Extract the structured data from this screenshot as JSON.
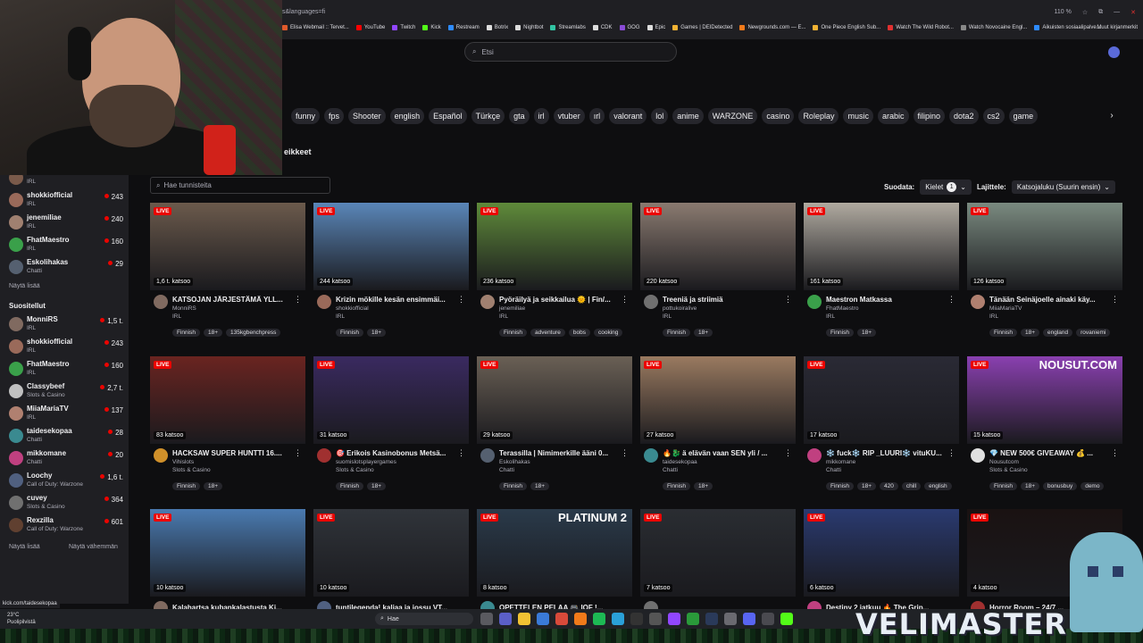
{
  "browser": {
    "url_fragment": "s&languages=fi",
    "zoom": "110 %",
    "bookmarks": [
      {
        "label": "Elisa Webmail :: Tervet...",
        "color": "#e05a2b"
      },
      {
        "label": "YouTube",
        "color": "#ff0000"
      },
      {
        "label": "Twitch",
        "color": "#9146ff"
      },
      {
        "label": "Kick",
        "color": "#53fc18"
      },
      {
        "label": "Restream",
        "color": "#2e8bff"
      },
      {
        "label": "Botrix",
        "color": "#dddddd"
      },
      {
        "label": "Nightbot",
        "color": "#dddddd"
      },
      {
        "label": "Streamlabs",
        "color": "#31c3a2"
      },
      {
        "label": "CDK",
        "color": "#dddddd"
      },
      {
        "label": "GOG",
        "color": "#8a4bd6"
      },
      {
        "label": "Epic",
        "color": "#dddddd"
      },
      {
        "label": "Games | DEIDetected",
        "color": "#f2b233"
      },
      {
        "label": "Newgrounds.com — E...",
        "color": "#f27a1a"
      },
      {
        "label": "One Piece English Sub...",
        "color": "#f2b233"
      },
      {
        "label": "Watch The Wild Robot...",
        "color": "#e03030"
      },
      {
        "label": "Watch Novocaine Engl...",
        "color": "#888888"
      },
      {
        "label": "Aikuisten sosiaalipalve...",
        "color": "#2e8bff"
      }
    ],
    "more_bookmarks": "Muut kirjanmerkit"
  },
  "search": {
    "placeholder": "Etsi"
  },
  "tags": [
    "funny",
    "fps",
    "Shooter",
    "english",
    "Español",
    "Türkçe",
    "gta",
    "irl",
    "vtuber",
    "ırl",
    "valorant",
    "lol",
    "anime",
    "WARZONE",
    "casino",
    "Roleplay",
    "music",
    "arabic",
    "filipino",
    "dota2",
    "cs2",
    "game"
  ],
  "section_label": "eikkeet",
  "sidebar": {
    "followed": [
      {
        "name": "",
        "category": "IRL",
        "viewers": "",
        "color": "#7a5a4a"
      },
      {
        "name": "shokkiofficial",
        "category": "IRL",
        "viewers": "243",
        "color": "#9a6a5a"
      },
      {
        "name": "jenemiliae",
        "category": "IRL",
        "viewers": "240",
        "color": "#a08070"
      },
      {
        "name": "FhatMaestro",
        "category": "IRL",
        "viewers": "160",
        "color": "#3aa04a"
      },
      {
        "name": "Eskolihakas",
        "category": "Chatti",
        "viewers": "29",
        "color": "#556070"
      }
    ],
    "show_more": "Näytä lisää",
    "recommended_title": "Suositellut",
    "recommended": [
      {
        "name": "MonniRS",
        "category": "IRL",
        "viewers": "1,5 t.",
        "color": "#806a60"
      },
      {
        "name": "shokkiofficial",
        "category": "IRL",
        "viewers": "243",
        "color": "#9a6a5a"
      },
      {
        "name": "FhatMaestro",
        "category": "IRL",
        "viewers": "160",
        "color": "#3aa04a"
      },
      {
        "name": "Classybeef",
        "category": "Slots & Casino",
        "viewers": "2,7 t.",
        "color": "#c0c0c0"
      },
      {
        "name": "MiiaMariaTV",
        "category": "IRL",
        "viewers": "137",
        "color": "#b08070"
      },
      {
        "name": "taidesekopaa",
        "category": "Chatti",
        "viewers": "28",
        "color": "#3a8a90"
      },
      {
        "name": "mikkomane",
        "category": "Chatti",
        "viewers": "20",
        "color": "#c04080"
      },
      {
        "name": "Loochy",
        "category": "Call of Duty: Warzone",
        "viewers": "1,6 t.",
        "color": "#506080"
      },
      {
        "name": "cuvey",
        "category": "Slots & Casino",
        "viewers": "364",
        "color": "#707070"
      },
      {
        "name": "Rexzilla",
        "category": "Call of Duty: Warzone",
        "viewers": "601",
        "color": "#604030"
      }
    ],
    "show_more_2": "Näytä lisää",
    "show_less": "Näytä vähemmän"
  },
  "filters": {
    "tag_placeholder": "Hae tunnisteita",
    "filter_label": "Suodata:",
    "lang_label": "Kielet",
    "lang_count": "1",
    "sort_label": "Lajittele:",
    "sort_value": "Katsojaluku (Suurin ensin)"
  },
  "live_label": "LIVE",
  "streams_row1": [
    {
      "viewers": "1,6 t. katsoo",
      "title": "KATSOJAN JÄRJESTÄMÄ YLL...",
      "channel": "MonniRS",
      "category": "IRL",
      "tags": [
        "Finnish",
        "18+",
        "135kgbenchpress"
      ],
      "thumb": "#6b5a4c",
      "av": "#806a60"
    },
    {
      "viewers": "244 katsoo",
      "title": "Krizin mökille kesän ensimmäi...",
      "channel": "shokkiofficial",
      "category": "IRL",
      "tags": [
        "Finnish",
        "18+"
      ],
      "thumb": "#5a86b8",
      "av": "#9a6a5a"
    },
    {
      "viewers": "236 katsoo",
      "title": "Pyöräilyä ja seikkailua 🌞 | Fin/...",
      "channel": "jenemiliae",
      "category": "IRL",
      "tags": [
        "Finnish",
        "adventure",
        "bobs",
        "cooking"
      ],
      "thumb": "#5f8a3a",
      "av": "#a08070"
    },
    {
      "viewers": "220 katsoo",
      "title": "Treeniä ja striimiä",
      "channel": "pottukoiralive",
      "category": "IRL",
      "tags": [
        "Finnish",
        "18+"
      ],
      "thumb": "#8a7a70",
      "av": "#707070"
    },
    {
      "viewers": "161 katsoo",
      "title": "Maestron Matkassa",
      "channel": "FhatMaestro",
      "category": "IRL",
      "tags": [
        "Finnish",
        "18+"
      ],
      "thumb": "#b0aaa0",
      "av": "#3aa04a"
    },
    {
      "viewers": "126 katsoo",
      "title": "Tänään Seinäjoelle ainaki käy...",
      "channel": "MiiaMariaTV",
      "category": "IRL",
      "tags": [
        "Finnish",
        "18+",
        "england",
        "rovaniemi"
      ],
      "thumb": "#7a8a80",
      "av": "#b08070"
    }
  ],
  "streams_row2": [
    {
      "viewers": "83 katsoo",
      "title": "HACKSAW SUPER HUNTTI 16....",
      "channel": "Vihislots",
      "category": "Slots & Casino",
      "tags": [
        "Finnish",
        "18+"
      ],
      "thumb": "#6a2420",
      "av": "#d0902a"
    },
    {
      "viewers": "31 katsoo",
      "title": "🎯 Erikois Kasinobonus Metsä...",
      "channel": "suomislotsplayergames",
      "category": "Slots & Casino",
      "tags": [
        "Finnish",
        "18+"
      ],
      "thumb": "#3a2a60",
      "av": "#a03030"
    },
    {
      "viewers": "29 katsoo",
      "title": "Terassilla | Nimimerkille ääni 0...",
      "channel": "Eskolihakas",
      "category": "Chatti",
      "tags": [
        "Finnish",
        "18+"
      ],
      "thumb": "#6a6055",
      "av": "#556070"
    },
    {
      "viewers": "27 katsoo",
      "title": "🔥🐉 ä elävän vaan SEN yli / ...",
      "channel": "taidesekopaa",
      "category": "Chatti",
      "tags": [
        "Finnish",
        "18+"
      ],
      "thumb": "#9a7a60",
      "av": "#3a8a90"
    },
    {
      "viewers": "17 katsoo",
      "title": "❄️ fuck❄️ RIP _LUURI❄️ vituKU...",
      "channel": "mikkomane",
      "category": "Chatti",
      "tags": [
        "Finnish",
        "18+",
        "420",
        "chill",
        "english"
      ],
      "thumb": "#2a2a35",
      "av": "#c04080"
    },
    {
      "viewers": "15 katsoo",
      "title": "💎 NEW 500€ GIVEAWAY 💰 ...",
      "channel": "Nousutcom",
      "category": "Slots & Casino",
      "tags": [
        "Finnish",
        "18+",
        "bonusbuy",
        "demo"
      ],
      "thumb": "#8a40b0",
      "av": "#e0e0e0",
      "overlay": "NOUSUT.COM"
    }
  ],
  "streams_row3": [
    {
      "viewers": "10 katsoo",
      "title": "Kalahartsa kubankalastusta Ki...",
      "thumb": "#4a7ab0",
      "av": "#806a60"
    },
    {
      "viewers": "10 katsoo",
      "title": "tuntilegenda! kaljaa ja jossu VT...",
      "thumb": "#30343a",
      "av": "#506080"
    },
    {
      "viewers": "8 katsoo",
      "title": "OPETTELEN PELAA 🎮 IOF !...",
      "thumb": "#2a3a4a",
      "av": "#3a8a90",
      "overlay": "PLATINUM 2"
    },
    {
      "viewers": "7 katsoo",
      "title": "",
      "thumb": "#2a2d32",
      "av": "#707070"
    },
    {
      "viewers": "6 katsoo",
      "title": "Destiny 2 jatkuu 🔥 The Grip...",
      "thumb": "#2a3a70",
      "av": "#c04080"
    },
    {
      "viewers": "4 katsoo",
      "title": "Horror Room – 24/7 ...",
      "thumb": "#1a1212",
      "av": "#a03030"
    }
  ],
  "status_url": "kick.com/taidesekopaa",
  "weather": {
    "temp": "23°C",
    "desc": "Puolipilvistä"
  },
  "win_search": "Hae",
  "overlay_text": "VELIMASTER"
}
